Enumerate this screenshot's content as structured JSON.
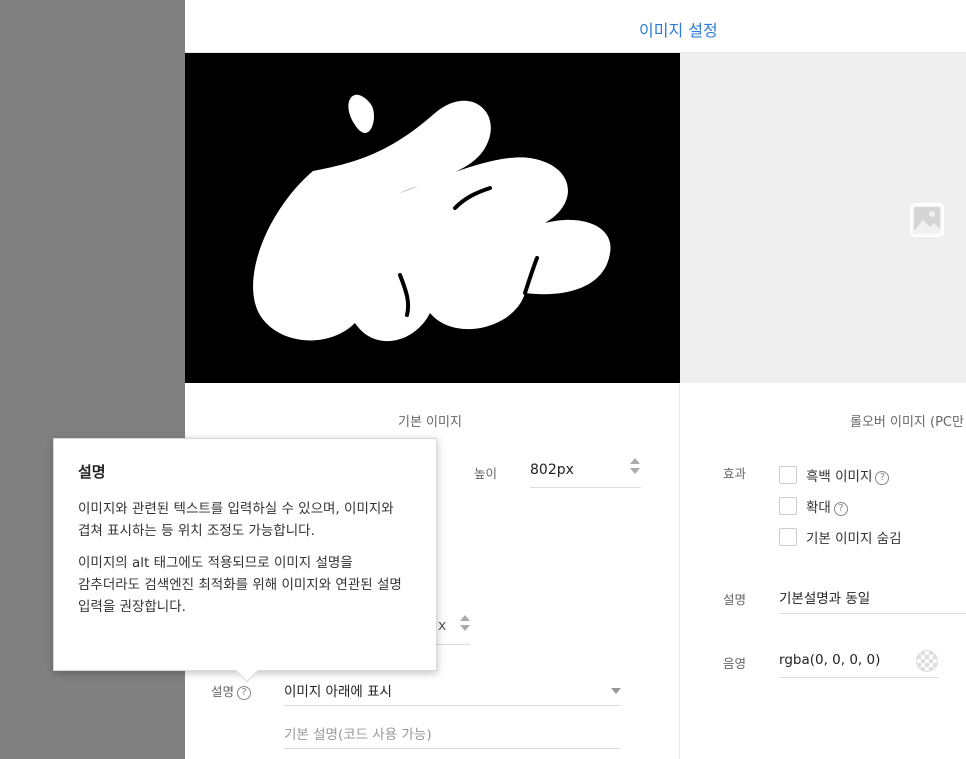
{
  "dialog": {
    "title": "이미지 설정"
  },
  "base": {
    "column_title": "기본 이미지",
    "height_label": "높이",
    "height_value": "802px",
    "hidden_unit_fragment": "x",
    "desc_label": "설명",
    "desc_select_value": "이미지 아래에 표시",
    "desc_placeholder": "기본 설명(코드 사용 가능)"
  },
  "rollover": {
    "column_title": "롤오버 이미지 (PC만",
    "effect_label": "효과",
    "effects": [
      {
        "label": "흑백 이미지",
        "help": true,
        "checked": false
      },
      {
        "label": "확대",
        "help": true,
        "checked": false
      },
      {
        "label": "기본 이미지 숨김",
        "help": false,
        "checked": false
      }
    ],
    "desc_label": "설명",
    "desc_value": "기본설명과 동일",
    "shadow_label": "음영",
    "shadow_value": "rgba(0, 0, 0, 0)"
  },
  "tooltip": {
    "title": "설명",
    "paragraph1": "이미지와 관련된 텍스트를 입력하실 수 있으며, 이미지와 겹쳐 표시하는 등 위치 조정도 가능합니다.",
    "paragraph2": "이미지의 alt 태그에도 적용되므로 이미지 설명을 감추더라도 검색엔진 최적화를 위해 이미지와 연관된 설명 입력을 권장합니다."
  },
  "icons": {
    "help": "question-circle-icon",
    "placeholder_image": "image-placeholder-icon"
  },
  "colors": {
    "accent": "#2b7bde",
    "overlay": "#808080",
    "preview_bg": "#000000",
    "logo": "#ffffff"
  }
}
